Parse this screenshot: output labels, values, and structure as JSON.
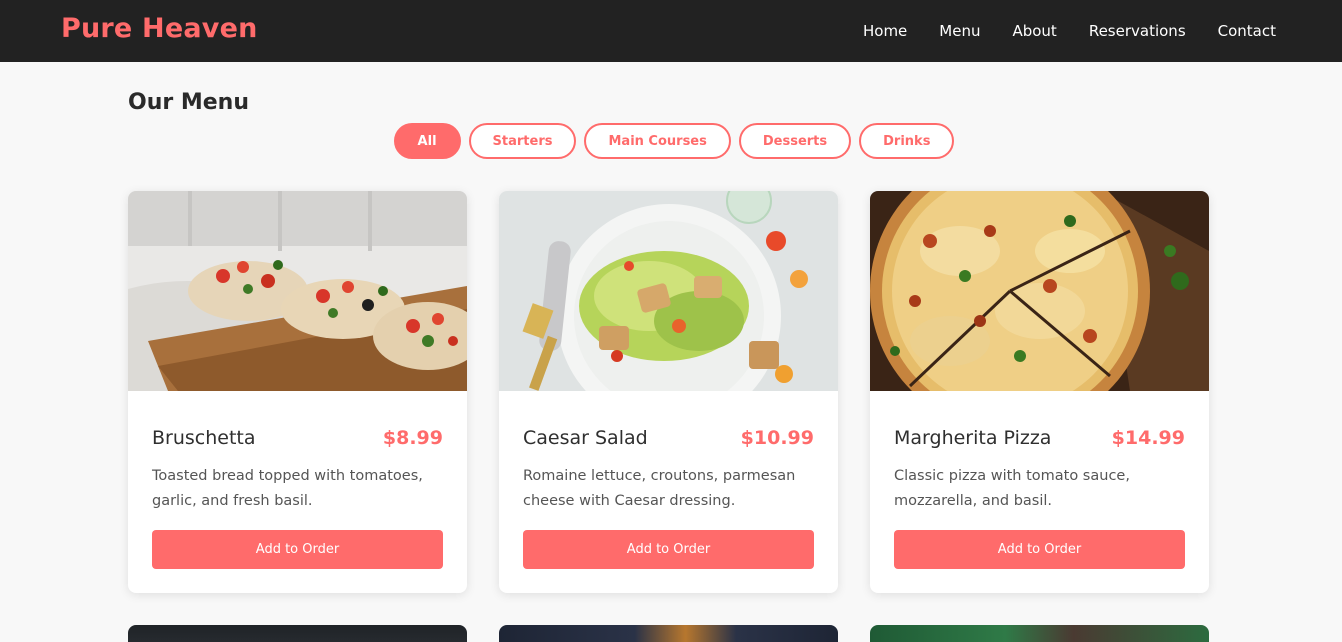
{
  "brand": "Pure Heaven",
  "nav": [
    "Home",
    "Menu",
    "About",
    "Reservations",
    "Contact"
  ],
  "page_title": "Our Menu",
  "filters": [
    "All",
    "Starters",
    "Main Courses",
    "Desserts",
    "Drinks"
  ],
  "active_filter": "All",
  "items": [
    {
      "name": "Bruschetta",
      "price": "$8.99",
      "description": "Toasted bread topped with tomatoes, garlic, and fresh basil.",
      "button": "Add to Order"
    },
    {
      "name": "Caesar Salad",
      "price": "$10.99",
      "description": "Romaine lettuce, croutons, parmesan cheese with Caesar dressing.",
      "button": "Add to Order"
    },
    {
      "name": "Margherita Pizza",
      "price": "$14.99",
      "description": "Classic pizza with tomato sauce, mozzarella, and basil.",
      "button": "Add to Order"
    }
  ],
  "colors": {
    "accent": "#ff6b6b",
    "navbar": "#222222",
    "background": "#f8f8f8"
  }
}
